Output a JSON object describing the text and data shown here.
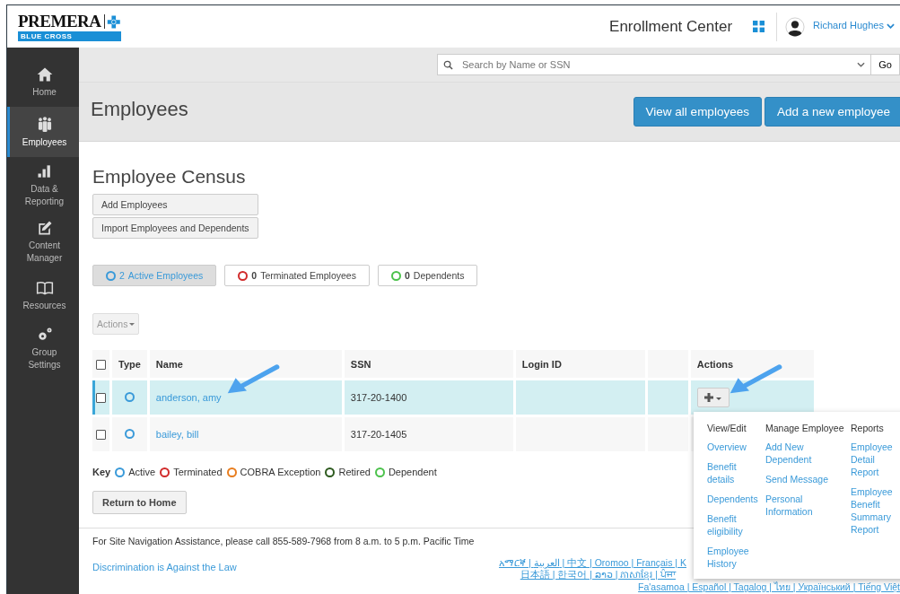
{
  "header": {
    "logo": {
      "name": "PREMERA",
      "tagline": "BLUE CROSS"
    },
    "title": "Enrollment Center",
    "user": "Richard Hughes"
  },
  "sidebar": {
    "items": [
      {
        "label": "Home",
        "selected": false
      },
      {
        "label": "Employees",
        "selected": true
      },
      {
        "label": "Data & Reporting",
        "selected": false
      },
      {
        "label": "Content Manager",
        "selected": false
      },
      {
        "label": "Resources",
        "selected": false
      },
      {
        "label": "Group Settings",
        "selected": false
      }
    ]
  },
  "search": {
    "placeholder": "Search by Name or SSN",
    "button": "Go"
  },
  "page": {
    "title": "Employees",
    "buttons": [
      "View all employees",
      "Add a new employee"
    ]
  },
  "census": {
    "title": "Employee Census",
    "buttons": [
      "Add Employees",
      "Import Employees and Dependents"
    ],
    "filters": [
      {
        "count": "2",
        "label": "Active Employees",
        "color": "#3a9ad9",
        "selected": true
      },
      {
        "count": "0",
        "label": "Terminated Employees",
        "color": "#d12b2b",
        "selected": false
      },
      {
        "count": "0",
        "label": "Dependents",
        "color": "#4cc24c",
        "selected": false
      }
    ],
    "actions_button": "Actions"
  },
  "table": {
    "select_all_checked": false,
    "columns": [
      "Type",
      "Name",
      "SSN",
      "Login ID",
      "Actions"
    ],
    "rows": [
      {
        "name": "anderson, amy",
        "ssn": "317-20-1400",
        "color": "#3a9ad9",
        "checked": false,
        "selected": true
      },
      {
        "name": "bailey, bill",
        "ssn": "317-20-1405",
        "color": "#3a9ad9",
        "checked": false,
        "selected": false
      }
    ]
  },
  "key": {
    "label": "Key",
    "items": [
      {
        "label": "Active",
        "color": "#3a9ad9"
      },
      {
        "label": "Terminated",
        "color": "#d12b2b"
      },
      {
        "label": "COBRA Exception",
        "color": "#e87d1e"
      },
      {
        "label": "Retired",
        "color": "#2d5a1e"
      },
      {
        "label": "Dependent",
        "color": "#4cc24c"
      }
    ]
  },
  "return_button": "Return to Home",
  "footer": {
    "assistance": "For Site Navigation Assistance, please call 855-589-7968 from 8 a.m. to 5 p.m. Pacific Time",
    "link": "Discrimination is Against the Law",
    "languages": [
      "አማርኛ | العربية | 中文 | Oromoo | Français | K",
      "日本語 | 한국어 | ລາວ | ភាសាខ្មែរ | ਪੰਜਾ",
      "Fa'asamoa | Español | Tagalog | ไทย | Український | Tiếng Việt"
    ]
  },
  "actions_menu": {
    "columns": [
      {
        "heading": "View/Edit",
        "items": [
          "Overview",
          "Benefit details",
          "Dependents",
          "Benefit eligibility",
          "Employee History"
        ]
      },
      {
        "heading": "Manage Employee",
        "items": [
          "Add New Dependent",
          "Send Message",
          "Personal Information"
        ]
      },
      {
        "heading": "Reports",
        "items": [
          "Employee Detail Report",
          "Employee Benefit Summary Report"
        ]
      }
    ]
  }
}
